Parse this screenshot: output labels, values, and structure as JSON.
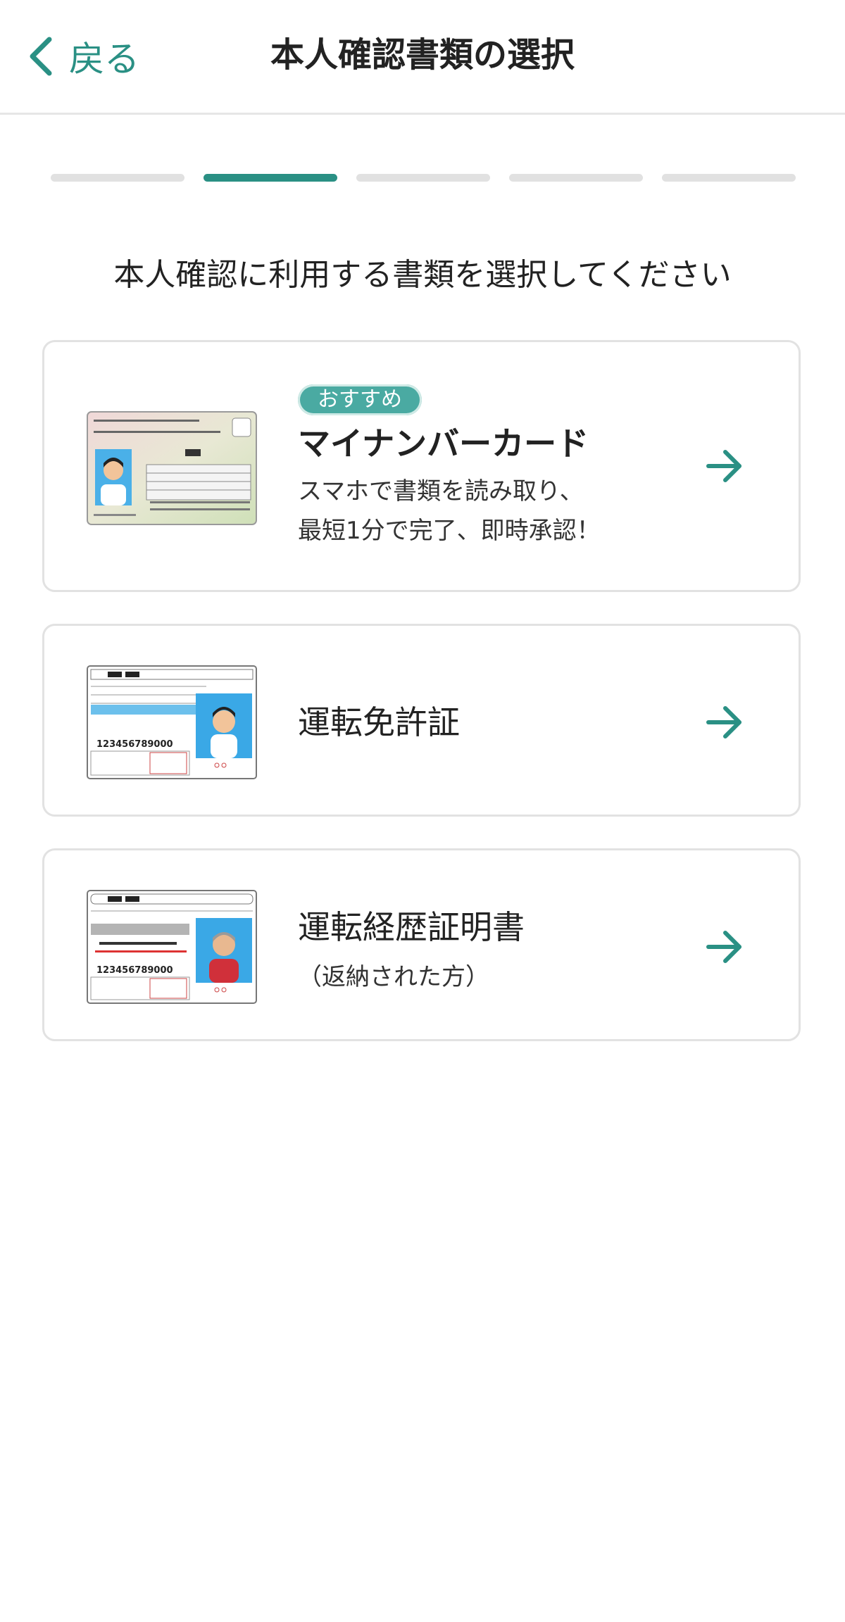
{
  "header": {
    "back_label": "戻る",
    "title": "本人確認書類の選択"
  },
  "progress": {
    "total_steps": 5,
    "current_step": 2
  },
  "instruction": "本人確認に利用する書類を選択してください",
  "colors": {
    "accent": "#2a9084",
    "badge": "#4aaaa2",
    "border": "#e2e2e2",
    "inactive_step": "#e1e1e1"
  },
  "documents": [
    {
      "badge": "おすすめ",
      "title": "マイナンバーカード",
      "desc_line1": "スマホで書類を読み取り、",
      "desc_line2": "最短1分で完了、即時承認！",
      "icon": "my-number-card-image"
    },
    {
      "title": "運転免許証",
      "icon": "drivers-license-image"
    },
    {
      "title": "運転経歴証明書",
      "subtitle": "（返納された方）",
      "icon": "driving-history-certificate-image"
    }
  ]
}
